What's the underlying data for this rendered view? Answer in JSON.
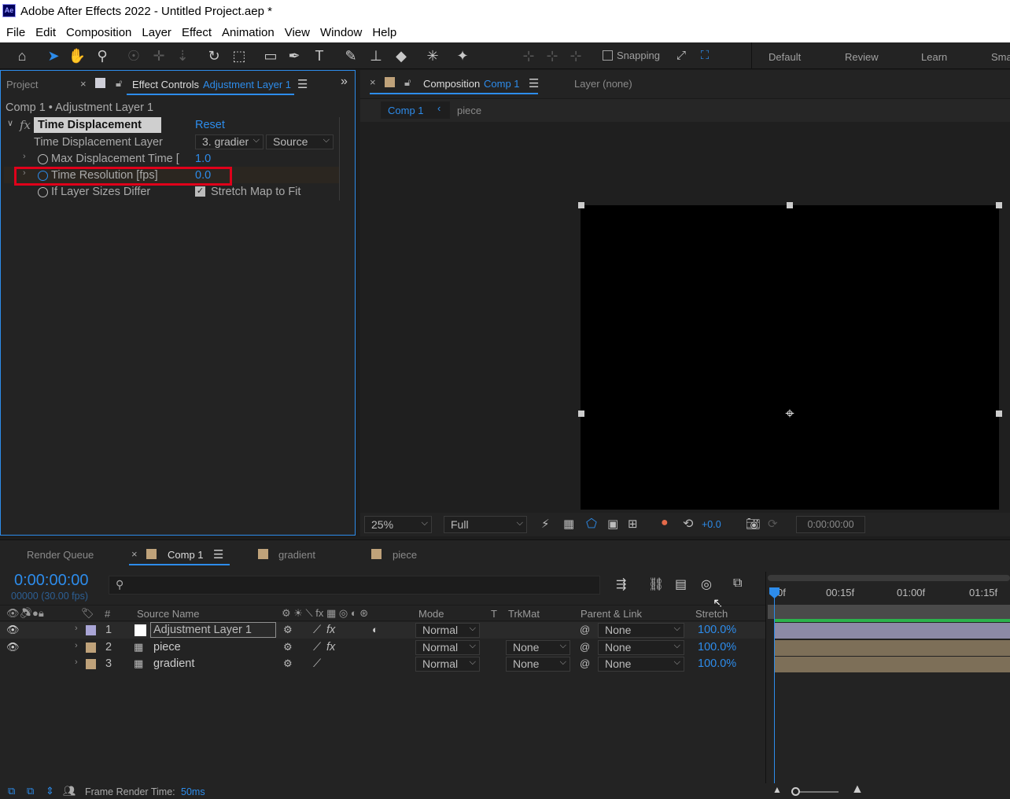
{
  "app": {
    "title": "Adobe After Effects 2022 - Untitled Project.aep *",
    "icon_text": "Ae"
  },
  "menu": [
    "File",
    "Edit",
    "Composition",
    "Layer",
    "Effect",
    "Animation",
    "View",
    "Window",
    "Help"
  ],
  "toolbar": {
    "snapping_label": "Snapping",
    "workspaces": [
      "Default",
      "Review",
      "Learn",
      "Sma"
    ]
  },
  "left_panel": {
    "tab_project": "Project",
    "tab_effect_controls": "Effect Controls",
    "tab_effect_controls_layer": "Adjustment Layer 1",
    "breadcrumb": "Comp 1 • Adjustment Layer 1",
    "effect": {
      "fx_label": "fx",
      "name": "Time Displacement",
      "reset_label": "Reset",
      "props": [
        {
          "label": "Time Displacement Layer",
          "value": "3. gradier",
          "value2": "Source"
        },
        {
          "label": "Max Displacement Time [",
          "value": "1.0"
        },
        {
          "label": "Time Resolution [fps]",
          "value": "0.0"
        },
        {
          "label": "If Layer Sizes Differ",
          "value": "Stretch Map to Fit"
        }
      ]
    }
  },
  "comp_panel": {
    "tab_label": "Composition",
    "comp_name": "Comp 1",
    "layer_tab": "Layer (none)",
    "flow": [
      "Comp 1",
      "piece"
    ],
    "zoom": "25%",
    "resolution": "Full",
    "exposure": "+0.0",
    "timecode": "0:00:00:00"
  },
  "timeline": {
    "tabs": [
      {
        "label": "Render Queue"
      },
      {
        "label": "Comp 1",
        "color": "#bfa27a"
      },
      {
        "label": "gradient",
        "color": "#bfa27a"
      },
      {
        "label": "piece",
        "color": "#bfa27a"
      }
    ],
    "timecode": "0:00:00:00",
    "frame_info": "00000 (30.00 fps)",
    "columns": {
      "num": "#",
      "source": "Source Name",
      "mode": "Mode",
      "t": "T",
      "trkmat": "TrkMat",
      "parent": "Parent & Link",
      "stretch": "Stretch"
    },
    "ruler": [
      "0f",
      "00:15f",
      "01:00f",
      "01:15f"
    ],
    "layers": [
      {
        "num": "1",
        "name": "Adjustment Layer 1",
        "mode": "Normal",
        "trkmat": "",
        "parent": "None",
        "stretch": "100.0%",
        "label_color": "#a9a5d6",
        "visible": true,
        "fx": true
      },
      {
        "num": "2",
        "name": "piece",
        "mode": "Normal",
        "trkmat": "None",
        "parent": "None",
        "stretch": "100.0%",
        "label_color": "#bfa27a",
        "visible": true,
        "fx": true
      },
      {
        "num": "3",
        "name": "gradient",
        "mode": "Normal",
        "trkmat": "None",
        "parent": "None",
        "stretch": "100.0%",
        "label_color": "#bfa27a",
        "visible": false,
        "fx": false
      }
    ]
  },
  "status": {
    "label": "Frame Render Time:",
    "value": "50ms"
  }
}
